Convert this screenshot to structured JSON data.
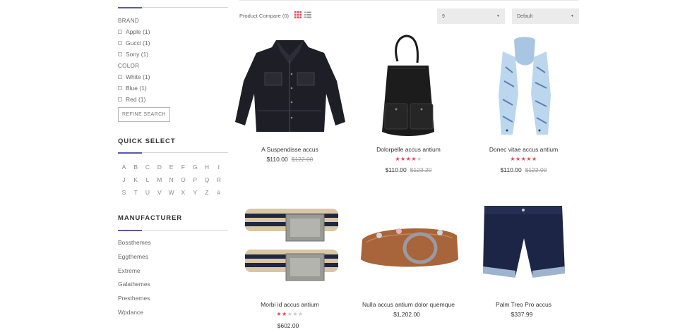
{
  "filters": {
    "brand_label": "BRAND",
    "brands": [
      {
        "label": "Apple (1)"
      },
      {
        "label": "Gucci (1)"
      },
      {
        "label": "Sony (1)"
      }
    ],
    "color_label": "COLOR",
    "colors": [
      {
        "label": "White (1)"
      },
      {
        "label": "Blue (1)"
      },
      {
        "label": "Red (1)"
      }
    ],
    "refine_button": "REFINE SEARCH"
  },
  "quick_select": {
    "title": "QUICK SELECT",
    "letters": [
      "A",
      "B",
      "C",
      "D",
      "E",
      "F",
      "G",
      "H",
      "I",
      "J",
      "K",
      "L",
      "M",
      "N",
      "O",
      "P",
      "Q",
      "R",
      "S",
      "T",
      "U",
      "V",
      "W",
      "X",
      "Y",
      "Z",
      "#"
    ]
  },
  "manufacturer": {
    "title": "MANUFACTURER",
    "items": [
      "Bossthemes",
      "Eggthemes",
      "Extreme",
      "Galathemes",
      "Presthemes",
      "Wpdance"
    ]
  },
  "toolbar": {
    "compare_label": "Product Compare (0)",
    "limit_value": "9",
    "sort_value": "Default",
    "grid_icon": "grid-view-icon",
    "list_icon": "list-view-icon",
    "view_active_color": "#e24553"
  },
  "colors": {
    "accent": "#5a5aa6",
    "star_active": "#e24553",
    "star_inactive": "#c9c9c9"
  },
  "products": [
    {
      "name": "A Suspendisse accus",
      "price": "$110.00",
      "old_price": "$122.00",
      "rating": null,
      "image": "denim-jacket"
    },
    {
      "name": "Dolorpelle accus antium",
      "price": "$110.00",
      "old_price": "$123.20",
      "rating": 4,
      "image": "black-handbag"
    },
    {
      "name": "Donec vitae accus antium",
      "price": "$110.00",
      "old_price": "$122.00",
      "rating": 5,
      "image": "blue-scarf"
    },
    {
      "name": "Morbi id accus antium",
      "price": "$602.00",
      "old_price": "",
      "rating": 2,
      "image": "striped-belts"
    },
    {
      "name": "Nulla accus antium dolor quemque",
      "price": "$1,202.00",
      "old_price": "",
      "rating": null,
      "image": "leather-belt"
    },
    {
      "name": "Palm Treo Pro accus",
      "price": "$337.99",
      "old_price": "",
      "rating": null,
      "image": "navy-shorts"
    }
  ]
}
